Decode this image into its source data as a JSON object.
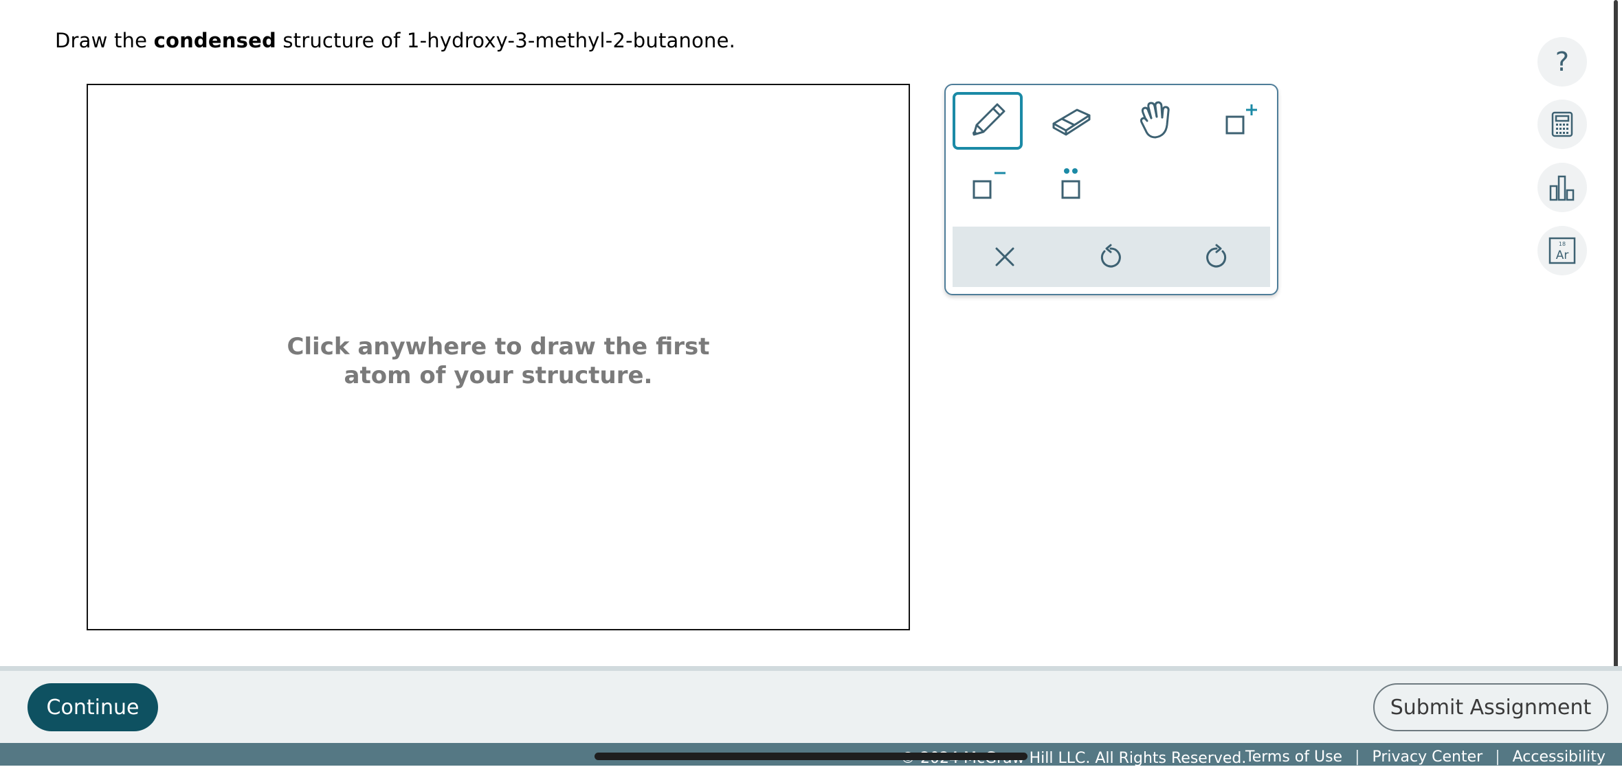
{
  "question": {
    "prefix": "Draw the ",
    "bold": "condensed",
    "suffix": " structure of 1-hydroxy-3-methyl-2-butanone."
  },
  "canvas": {
    "hint_line1": "Click anywhere to draw the first",
    "hint_line2": "atom of your structure."
  },
  "toolbox": {
    "tools": [
      {
        "icon": "pencil-icon",
        "active": true
      },
      {
        "icon": "eraser-icon",
        "active": false
      },
      {
        "icon": "hand-icon",
        "active": false
      },
      {
        "icon": "increase-charge-icon",
        "active": false
      },
      {
        "icon": "decrease-charge-icon",
        "active": false
      },
      {
        "icon": "lone-pair-icon",
        "active": false
      }
    ],
    "actions": [
      {
        "icon": "clear-icon"
      },
      {
        "icon": "undo-icon"
      },
      {
        "icon": "redo-icon"
      }
    ],
    "accent_color": "#1b8aa6",
    "icon_color": "#3d6172"
  },
  "side_tools": {
    "help_label": "?",
    "items": [
      "help-icon",
      "calculator-icon",
      "data-chart-icon",
      "periodic-table-icon"
    ],
    "periodic_table_number": "18",
    "periodic_table_symbol": "Ar"
  },
  "footer": {
    "continue_label": "Continue",
    "submit_label": "Submit Assignment",
    "copyright": "© 2024 McGraw Hill LLC. All Rights Reserved.",
    "links": [
      "Terms of Use",
      "Privacy Center",
      "Accessibility"
    ],
    "separator": "|",
    "continue_color": "#0e5161",
    "legal_bar_color": "#557884"
  }
}
